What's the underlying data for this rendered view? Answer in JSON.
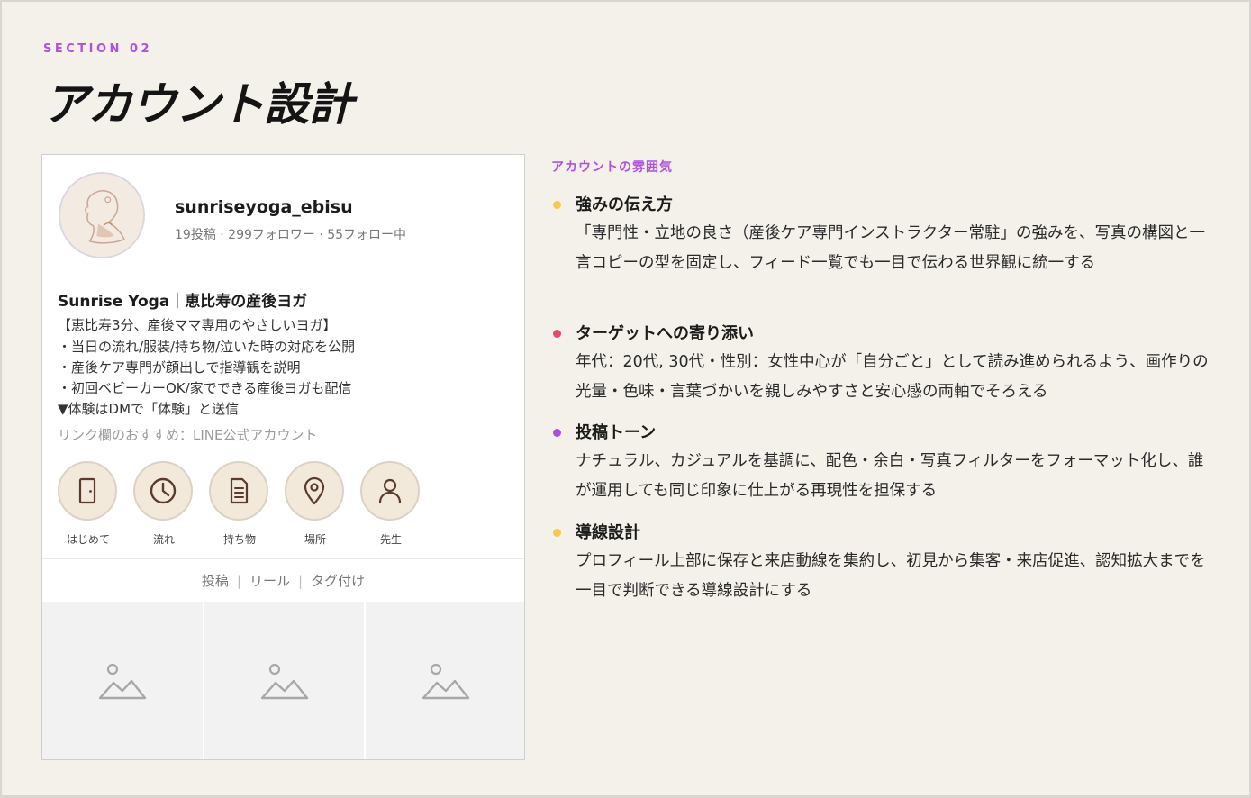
{
  "section_label": "SECTION 02",
  "page_title": "アカウント設計",
  "profile": {
    "username": "sunriseyoga_ebisu",
    "stats": "19投稿 · 299フォロワー · 55フォロー中",
    "bio_name": "Sunrise Yoga｜恵比寿の産後ヨガ",
    "bio_lines": [
      "【恵比寿3分、産後ママ専用のやさしいヨガ】",
      "・当日の流れ/服装/持ち物/泣いた時の対応を公開",
      "・産後ケア専門が顔出しで指導観を説明",
      "・初回ベビーカーOK/家でできる産後ヨガも配信",
      "▼体験はDMで「体験」と送信"
    ],
    "link_note": "リンク欄のおすすめ：LINE公式アカウント",
    "highlights": [
      {
        "label": "はじめて",
        "icon": "door-icon"
      },
      {
        "label": "流れ",
        "icon": "clock-icon"
      },
      {
        "label": "持ち物",
        "icon": "document-icon"
      },
      {
        "label": "場所",
        "icon": "location-pin-icon"
      },
      {
        "label": "先生",
        "icon": "person-icon"
      }
    ],
    "tabs": [
      "投稿",
      "リール",
      "タグ付け"
    ]
  },
  "mood": {
    "label": "アカウントの雰囲気",
    "points": [
      {
        "title": "強みの伝え方",
        "color": "#f7c94b",
        "body": "「専門性・立地の良さ（産後ケア専門インストラクター常駐」の強みを、写真の構図と一言コピーの型を固定し、フィード一覧でも一目で伝わる世界観に統一する"
      },
      {
        "title": "ターゲットへの寄り添い",
        "color": "#e8486b",
        "body": "年代：20代, 30代・性別：女性中心が「自分ごと」として読み進められるよう、画作りの光量・色味・言葉づかいを親しみやすさと安心感の両軸でそろえる"
      },
      {
        "title": "投稿トーン",
        "color": "#a64fe0",
        "body": "ナチュラル、カジュアルを基調に、配色・余白・写真フィルターをフォーマット化し、誰が運用しても同じ印象に仕上がる再現性を担保する"
      },
      {
        "title": "導線設計",
        "color": "#f7c94b",
        "body": "プロフィール上部に保存と来店動線を集約し、初見から集客・来店促進、認知拡大までを一目で判断できる導線設計にする"
      }
    ]
  }
}
